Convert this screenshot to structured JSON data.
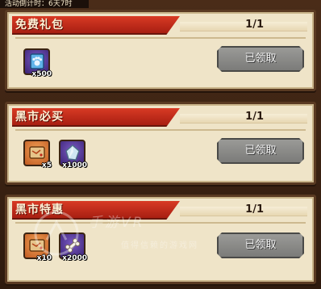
{
  "event_timer": "活动倒计时：6天7时",
  "sections": [
    {
      "title": "免费礼包",
      "count": "1/1",
      "button_label": "已领取",
      "items": [
        {
          "icon": "cat-paw-card-icon",
          "color": "purple",
          "qty": "x500"
        }
      ]
    },
    {
      "title": "黑市必买",
      "count": "1/1",
      "button_label": "已领取",
      "items": [
        {
          "icon": "scroll-map-icon",
          "color": "orange",
          "qty": "x5"
        },
        {
          "icon": "crystal-shard-icon",
          "color": "purple",
          "qty": "x1000"
        }
      ]
    },
    {
      "title": "黑市特惠",
      "count": "1/1",
      "button_label": "已领取",
      "items": [
        {
          "icon": "scroll-map-icon",
          "color": "orange",
          "qty": "x10"
        },
        {
          "icon": "bone-icon",
          "color": "purple",
          "qty": "x2000"
        }
      ]
    }
  ],
  "watermark": {
    "text": "手游VR",
    "subtext": "值得信赖的游戏网"
  },
  "colors": {
    "header_red": "#c42c1a",
    "card_bg": "#efe4c8",
    "button_gray": "#8a8a88",
    "page_bg": "#3a2416"
  }
}
